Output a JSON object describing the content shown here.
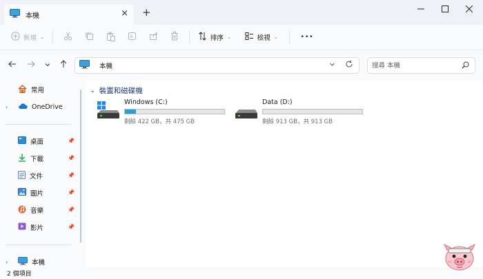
{
  "window": {
    "tab_title": "本機",
    "tab_icon": "computer-icon",
    "controls": [
      "minimize-icon",
      "maximize-icon",
      "close-icon"
    ]
  },
  "toolbar": {
    "new_label": "新增",
    "sort_label": "排序",
    "view_label": "檢視",
    "more_label": "•••",
    "disabled_actions": [
      "cut-icon",
      "copy-icon",
      "paste-icon",
      "rename-icon",
      "share-icon",
      "delete-icon"
    ]
  },
  "address": {
    "path": "本機",
    "search_placeholder": "搜尋 本機"
  },
  "sidebar": {
    "quick": [
      {
        "label": "常用",
        "icon": "home-icon"
      },
      {
        "label": "OneDrive",
        "icon": "cloud-icon"
      }
    ],
    "pinned": [
      {
        "label": "桌面",
        "icon": "desktop-icon"
      },
      {
        "label": "下載",
        "icon": "download-icon"
      },
      {
        "label": "文件",
        "icon": "document-icon"
      },
      {
        "label": "圖片",
        "icon": "pictures-icon"
      },
      {
        "label": "音樂",
        "icon": "music-icon"
      },
      {
        "label": "影片",
        "icon": "video-icon"
      }
    ],
    "this_pc": {
      "label": "本機",
      "icon": "computer-icon"
    }
  },
  "content": {
    "group_title": "裝置和磁碟機",
    "drives": [
      {
        "name": "Windows (C:)",
        "free_text": "剩餘 422 GB，共 475 GB",
        "used_fraction": 0.112,
        "icon": "windows-drive-icon"
      },
      {
        "name": "Data (D:)",
        "free_text": "剩餘 913 GB，共 913 GB",
        "used_fraction": 0.0,
        "icon": "drive-icon"
      }
    ]
  },
  "status": {
    "item_count": "2 個項目"
  },
  "colors": {
    "accent": "#26a0da",
    "group_header": "#1d3b72",
    "chrome": "#eef2f6",
    "pane": "#f9fafb"
  }
}
